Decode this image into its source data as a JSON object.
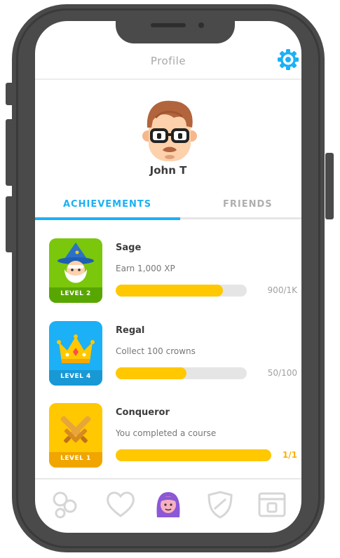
{
  "header": {
    "title": "Profile",
    "settings_icon": "gear-icon"
  },
  "user": {
    "name": "John T"
  },
  "tabs": [
    {
      "label": "ACHIEVEMENTS",
      "active": true
    },
    {
      "label": "FRIENDS",
      "active": false
    }
  ],
  "achievements": [
    {
      "name": "Sage",
      "description": "Earn 1,000 XP",
      "level_label": "LEVEL 2",
      "progress": 0.82,
      "count": "900/1K",
      "badge_color": "#7ac70c",
      "icon": "wizard-icon"
    },
    {
      "name": "Regal",
      "description": "Collect 100 crowns",
      "level_label": "LEVEL 4",
      "progress": 0.54,
      "count": "50/100",
      "badge_color": "#1cb0f6",
      "icon": "crown-icon"
    },
    {
      "name": "Conqueror",
      "description": "You completed a course",
      "level_label": "LEVEL 1",
      "progress": 1.0,
      "count": "1/1",
      "badge_color": "#ffc800",
      "icon": "crossed-swords-icon"
    }
  ],
  "nav": [
    {
      "icon": "learn-bubbles-icon",
      "active": false
    },
    {
      "icon": "heart-icon",
      "active": false
    },
    {
      "icon": "profile-avatar-icon",
      "active": true
    },
    {
      "icon": "shield-icon",
      "active": false
    },
    {
      "icon": "shop-icon",
      "active": false
    }
  ],
  "colors": {
    "accent": "#1cb0f6",
    "progress": "#ffc800",
    "frame": "#4a4a4a"
  }
}
